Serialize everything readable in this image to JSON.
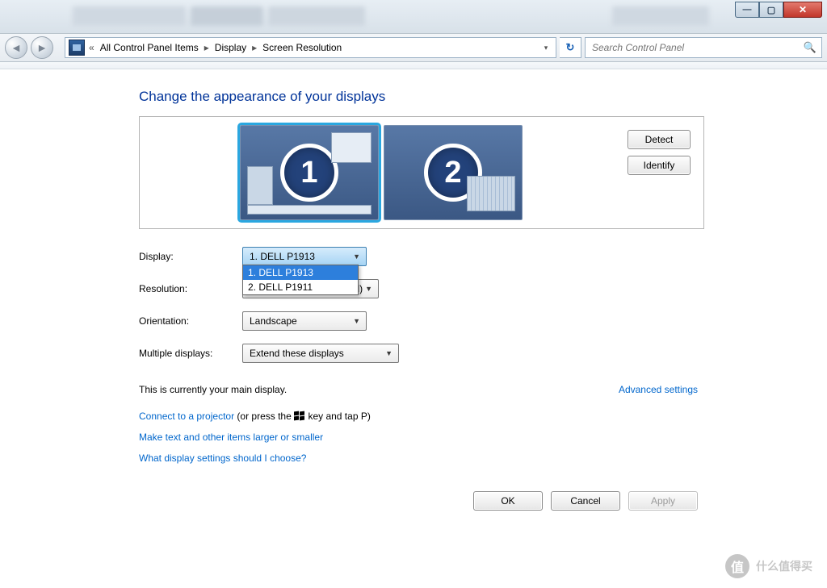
{
  "window_controls": {
    "minimize": "—",
    "maximize": "▢",
    "close": "✕"
  },
  "breadcrumb": {
    "prefix_double_arrow": "«",
    "items": [
      "All Control Panel Items",
      "Display",
      "Screen Resolution"
    ]
  },
  "search": {
    "placeholder": "Search Control Panel"
  },
  "page_title": "Change the appearance of your displays",
  "preview": {
    "monitor1_number": "1",
    "monitor2_number": "2",
    "detect_label": "Detect",
    "identify_label": "Identify"
  },
  "form": {
    "display_label": "Display:",
    "display_value": "1. DELL P1913",
    "display_options": [
      "1. DELL P1913",
      "2. DELL P1911"
    ],
    "resolution_label": "Resolution:",
    "resolution_value_suffix": "nmended)",
    "orientation_label": "Orientation:",
    "orientation_value": "Landscape",
    "multidisp_label": "Multiple displays:",
    "multidisp_value": "Extend these displays"
  },
  "status_text": "This is currently your main display.",
  "advanced_link": "Advanced settings",
  "links": {
    "projector_link": "Connect to a projector",
    "projector_suffix_a": " (or press the ",
    "projector_suffix_b": " key and tap P)",
    "text_size": "Make text and other items larger or smaller",
    "help": "What display settings should I choose?"
  },
  "buttons": {
    "ok": "OK",
    "cancel": "Cancel",
    "apply": "Apply"
  },
  "watermark": "什么值得买"
}
